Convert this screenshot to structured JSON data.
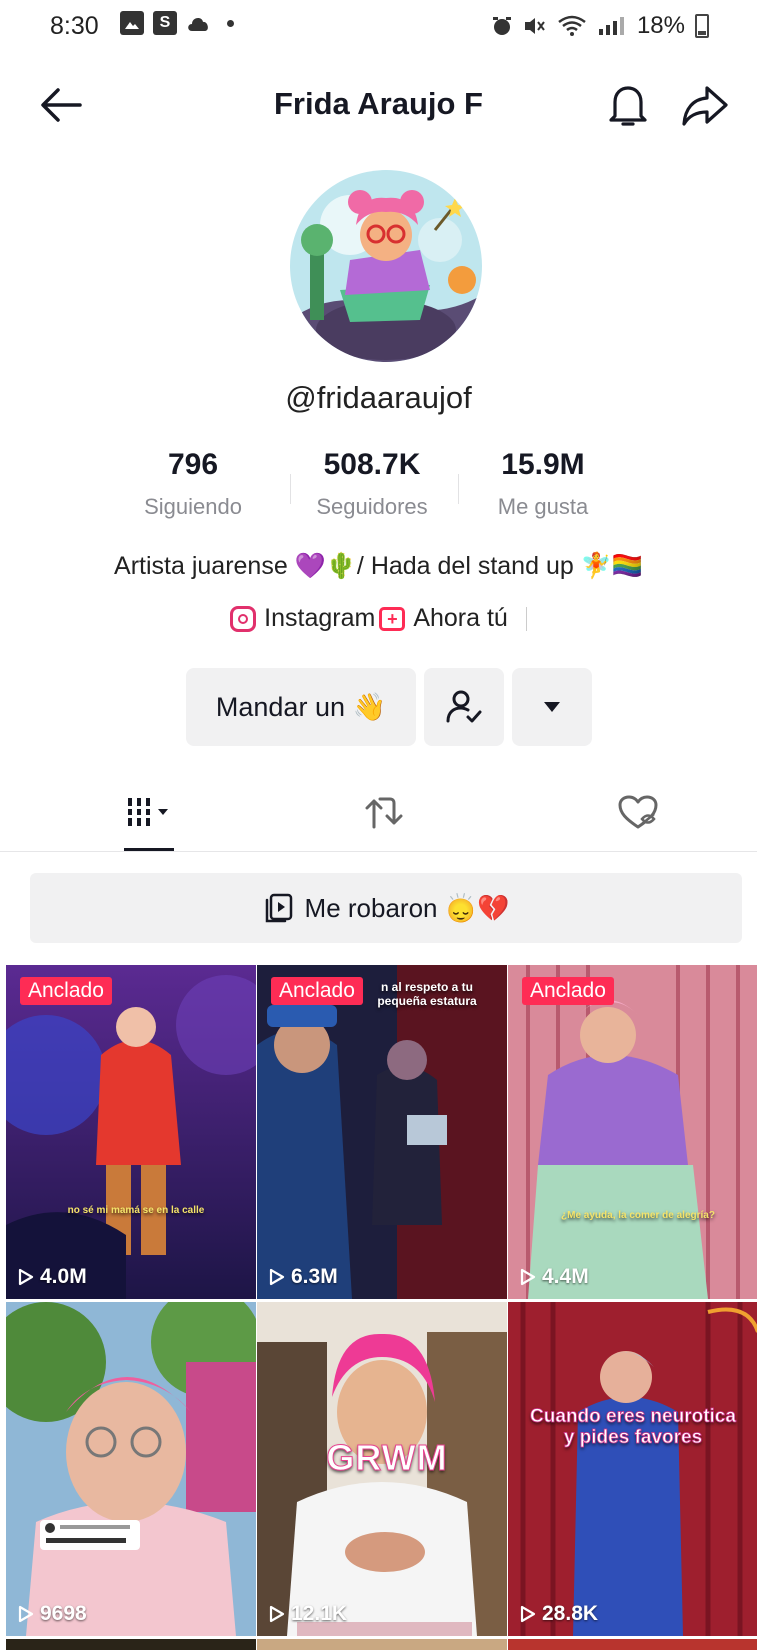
{
  "status_bar": {
    "time": "8:30",
    "s_icon": "S",
    "battery": "18%"
  },
  "header": {
    "title": "Frida Araujo F",
    "back_icon": "arrow-left-icon",
    "bell_icon": "bell-icon",
    "share_icon": "share-icon"
  },
  "profile": {
    "username": "@fridaaraujof",
    "stats": [
      {
        "value": "796",
        "label": "Siguiendo"
      },
      {
        "value": "508.7K",
        "label": "Seguidores"
      },
      {
        "value": "15.9M",
        "label": "Me gusta"
      }
    ],
    "bio": "Artista juarense 💜🌵/ Hada del stand up 🧚🏳️‍🌈",
    "links": [
      {
        "label": "Instagram"
      },
      {
        "label": "Ahora tú"
      }
    ]
  },
  "actions": {
    "message_label": "Mandar un 👋"
  },
  "playlist": {
    "label": "Me robaron 🙂‍↕️💔"
  },
  "videos": [
    {
      "views": "4.0M",
      "pinned": "Anclado",
      "caption": "no sé mi mamá se en la calle"
    },
    {
      "views": "6.3M",
      "pinned": "Anclado",
      "caption": "n al respeto a tu pequeña estatura"
    },
    {
      "views": "4.4M",
      "pinned": "Anclado",
      "caption": "¿Me ayuda, la comer de alegría?"
    },
    {
      "views": "9698",
      "pinned": "",
      "caption": ""
    },
    {
      "views": "12.1K",
      "pinned": "",
      "caption": "GRWM"
    },
    {
      "views": "28.8K",
      "pinned": "",
      "caption": "Cuando eres neurotica y pides favores"
    }
  ],
  "colors": {
    "accent": "#fe2c55",
    "text": "#161823",
    "muted": "#8a8b91",
    "button_bg": "#f1f1f2"
  }
}
